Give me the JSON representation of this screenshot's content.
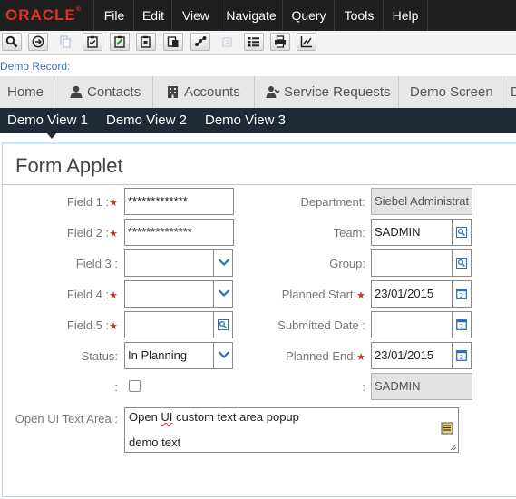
{
  "app": {
    "logo": "ORACLE",
    "logo_mark": "®"
  },
  "menu": [
    "File",
    "Edit",
    "View",
    "Navigate",
    "Query",
    "Tools",
    "Help"
  ],
  "toolbar": [
    {
      "icon": "search-icon"
    },
    {
      "icon": "go-icon"
    },
    {
      "icon": "copy-icon"
    },
    {
      "icon": "clipboard-check-icon"
    },
    {
      "icon": "clipboard-edit-icon"
    },
    {
      "icon": "document-icon"
    },
    {
      "icon": "paste-icon"
    },
    {
      "icon": "share-icon"
    },
    {
      "icon": "disabled-icon"
    },
    {
      "icon": "list-icon"
    },
    {
      "icon": "print-icon"
    },
    {
      "icon": "chart-icon"
    }
  ],
  "record_label": "Demo Record:",
  "screen_tabs": [
    {
      "label": "Home",
      "icon": ""
    },
    {
      "label": "Contacts",
      "icon": "person-icon"
    },
    {
      "label": "Accounts",
      "icon": "building-icon"
    },
    {
      "label": "Service Requests",
      "icon": "support-icon"
    },
    {
      "label": "Demo Screen",
      "icon": ""
    },
    {
      "label": "D",
      "icon": ""
    }
  ],
  "view_tabs": [
    "Demo View 1",
    "Demo View 2",
    "Demo View 3"
  ],
  "applet": {
    "title": "Form Applet",
    "left": {
      "field1": {
        "label": "Field 1 :",
        "value": "*************"
      },
      "field2": {
        "label": "Field 2 :",
        "value": "**************"
      },
      "field3": {
        "label": "Field 3 :",
        "value": ""
      },
      "field4": {
        "label": "Field 4 :",
        "value": ""
      },
      "field5": {
        "label": "Field 5 :",
        "value": ""
      },
      "status": {
        "label": "Status:",
        "value": "In Planning"
      },
      "checkbox": {
        "label": ":",
        "checked": false
      }
    },
    "right": {
      "department": {
        "label": "Department:",
        "value": "Siebel Administrat"
      },
      "team": {
        "label": "Team:",
        "value": "SADMIN"
      },
      "group": {
        "label": "Group:",
        "value": ""
      },
      "planned_start": {
        "label": "Planned Start:",
        "value": "23/01/2015"
      },
      "submitted_date": {
        "label": "Submitted Date :",
        "value": ""
      },
      "planned_end": {
        "label": "Planned End:",
        "value": "23/01/2015"
      },
      "owner": {
        "label": ":",
        "value": "SADMIN"
      }
    },
    "textarea": {
      "label": "Open UI Text Area :",
      "line1_a": "Open ",
      "line1_b": "UI",
      "line1_c": " custom text area popup",
      "line2": "demo text"
    }
  },
  "colors": {
    "menubar": "#1f1f1f",
    "viewbar": "#1f2a36",
    "required": "#c0392b",
    "accent": "#3b73b9"
  }
}
